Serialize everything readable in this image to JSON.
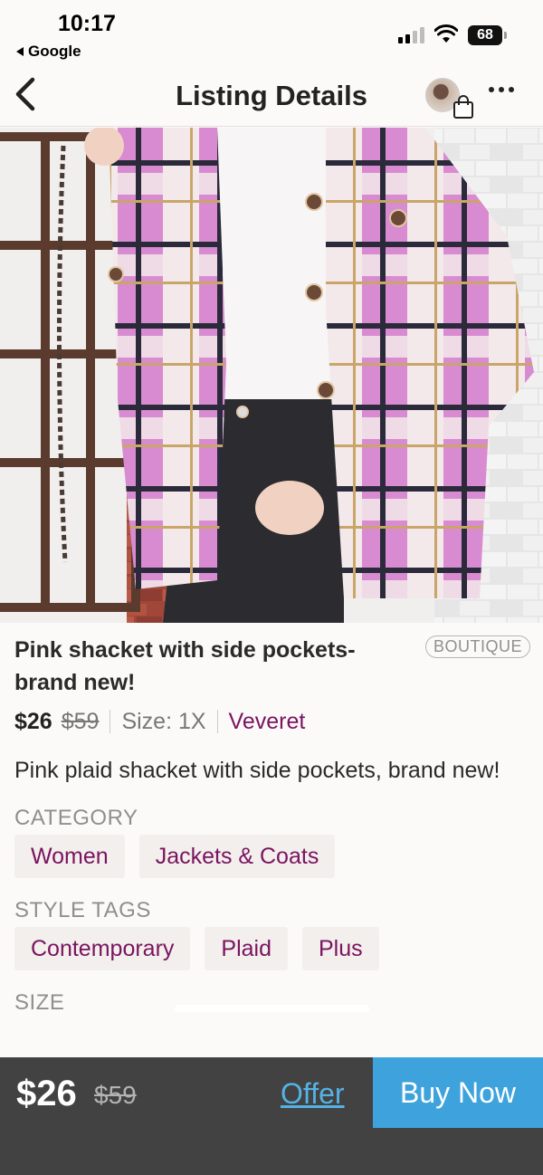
{
  "status_bar": {
    "time": "10:17",
    "back_app": "Google",
    "battery": "68"
  },
  "nav": {
    "title": "Listing Details"
  },
  "listing": {
    "title": "Pink shacket with side pockets- brand new!",
    "badge": "BOUTIQUE",
    "price": "$26",
    "original_price": "$59",
    "size": "Size: 1X",
    "brand": "Veveret",
    "description": "Pink plaid shacket with side pockets, brand new!",
    "category_label": "CATEGORY",
    "categories": [
      "Women",
      "Jackets & Coats"
    ],
    "style_tags_label": "STYLE TAGS",
    "style_tags": [
      "Contemporary",
      "Plaid",
      "Plus"
    ],
    "size_label": "SIZE"
  },
  "bottom_bar": {
    "price": "$26",
    "original_price": "$59",
    "offer_label": "Offer",
    "buy_label": "Buy Now"
  },
  "colors": {
    "brand_accent": "#7a1460",
    "buy_button": "#3ea3dc",
    "offer_link": "#55b2e4",
    "bottom_bar": "#424242"
  },
  "icons": [
    "back-chevron-icon",
    "wifi-icon",
    "shopping-bag-icon",
    "more-dots-icon"
  ]
}
